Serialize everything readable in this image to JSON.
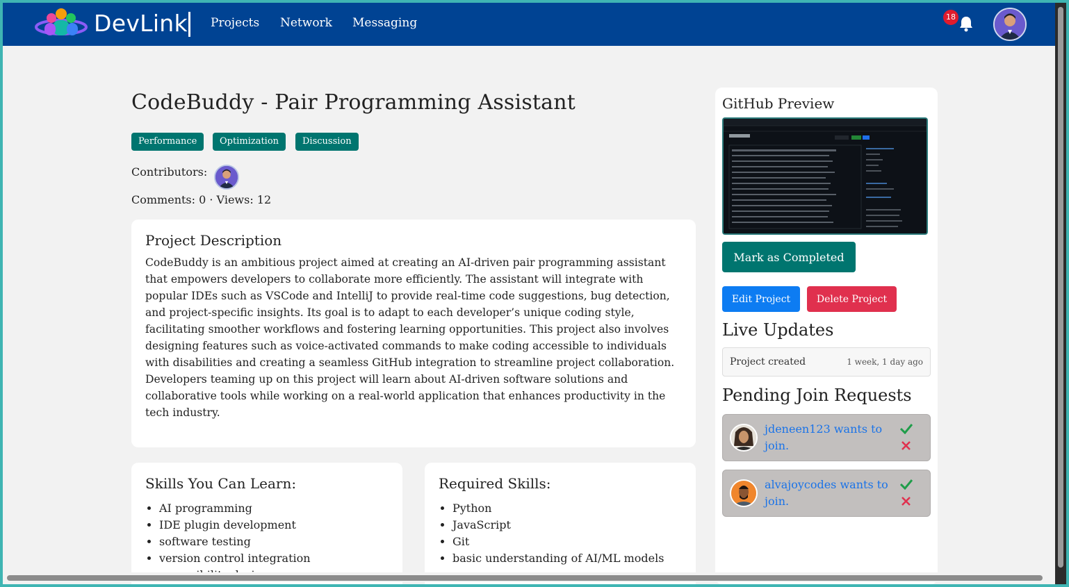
{
  "nav": {
    "brand": "DevLink",
    "links": [
      "Projects",
      "Network",
      "Messaging"
    ],
    "notification_count": "18"
  },
  "project": {
    "title": "CodeBuddy - Pair Programming Assistant",
    "tags": [
      "Performance",
      "Optimization",
      "Discussion"
    ],
    "contributors_label": "Contributors:",
    "stats": "Comments: 0 · Views: 12",
    "description_heading": "Project Description",
    "description": "CodeBuddy is an ambitious project aimed at creating an AI-driven pair programming assistant that empowers developers to collaborate more efficiently. The assistant will integrate with popular IDEs such as VSCode and IntelliJ to provide real-time code suggestions, bug detection, and project-specific insights. Its goal is to adapt to each developer’s unique coding style, facilitating smoother workflows and fostering learning opportunities. This project also involves designing features such as voice-activated commands to make coding accessible to individuals with disabilities and creating a seamless GitHub integration to streamline project collaboration. Developers teaming up on this project will learn about AI-driven software solutions and collaborative tools while working on a real-world application that enhances productivity in the tech industry.",
    "skills_learn_heading": "Skills You Can Learn:",
    "skills_learn": [
      "AI programming",
      "IDE plugin development",
      "software testing",
      "version control integration",
      "accessibility design"
    ],
    "skills_required_heading": "Required Skills:",
    "skills_required": [
      "Python",
      "JavaScript",
      "Git",
      "basic understanding of AI/ML models"
    ]
  },
  "sidebar": {
    "github_heading": "GitHub Preview",
    "mark_completed": "Mark as Completed",
    "edit": "Edit Project",
    "delete": "Delete Project",
    "live_updates_heading": "Live Updates",
    "updates": [
      {
        "text": "Project created",
        "time": "1 week, 1 day ago"
      }
    ],
    "join_heading": "Pending Join Requests",
    "requests": [
      {
        "text": "jdeneen123 wants to join."
      },
      {
        "text": "alvajoycodes wants to join."
      }
    ]
  },
  "colors": {
    "navbar": "#004393",
    "tag": "#00756f",
    "edit": "#0d7cf2",
    "delete": "#e0304e",
    "accept": "#1f9d4a",
    "decline": "#e0304e"
  }
}
